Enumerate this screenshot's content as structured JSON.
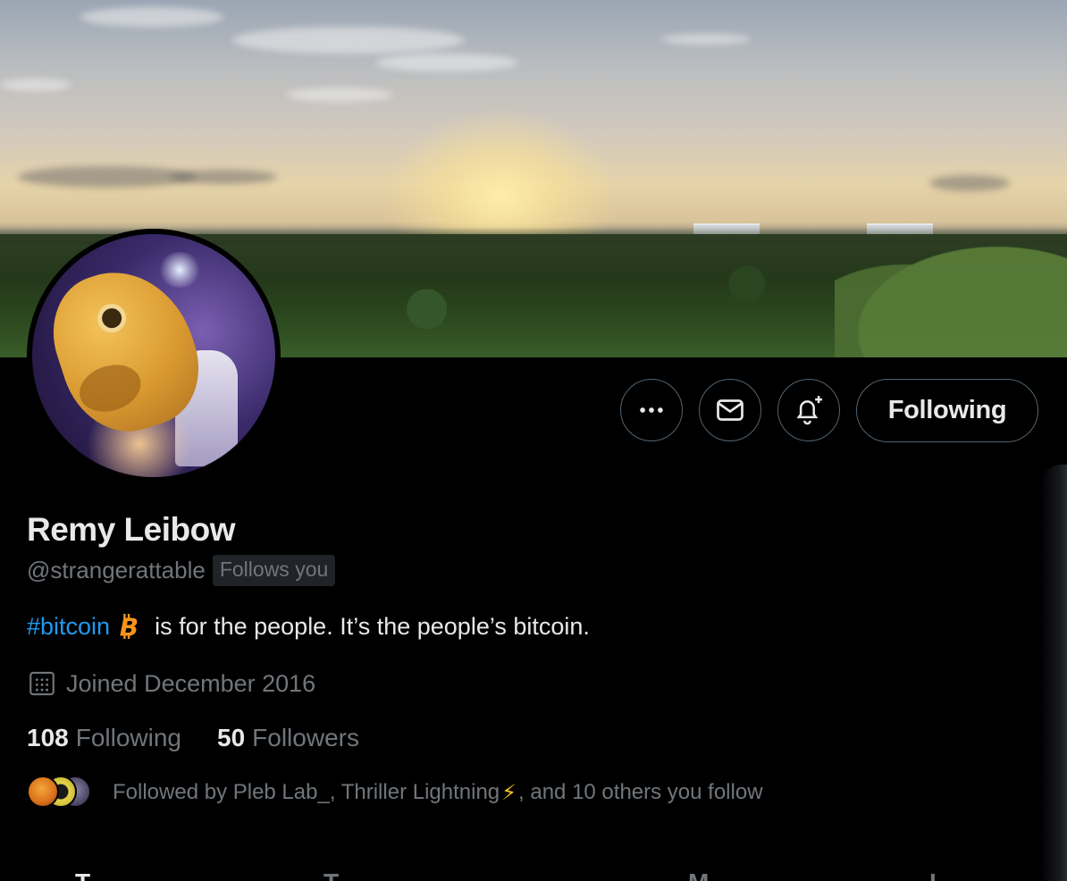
{
  "profile": {
    "name": "Remy Leibow",
    "handle": "@strangerattable",
    "follows_you_badge": "Follows you",
    "bio": {
      "hashtag": "#bitcoin",
      "emoji": "bitcoin-symbol",
      "text": "is for the people. It’s the people’s bitcoin."
    },
    "joined": "Joined December 2016",
    "stats": {
      "following_count": "108",
      "following_label": "Following",
      "followers_count": "50",
      "followers_label": "Followers"
    },
    "followed_by": {
      "prefix": "Followed by Pleb Lab_, Thriller Lightning",
      "bolt": "⚡",
      "suffix": ", and 10 others you follow"
    }
  },
  "actions": {
    "more_icon": "more-icon",
    "message_icon": "mail-icon",
    "notify_icon": "bell-plus-icon",
    "following_button": "Following"
  },
  "tabs": [
    {
      "label": "T",
      "active": true
    },
    {
      "label": "T",
      "active": false
    },
    {
      "label": "M",
      "active": false
    },
    {
      "label": "L",
      "active": false
    }
  ],
  "colors": {
    "background": "#000000",
    "primary_text": "#e7e9ea",
    "secondary_text": "#71767b",
    "link": "#1d9bf0",
    "bitcoin": "#f7931a",
    "border": "#536471"
  }
}
